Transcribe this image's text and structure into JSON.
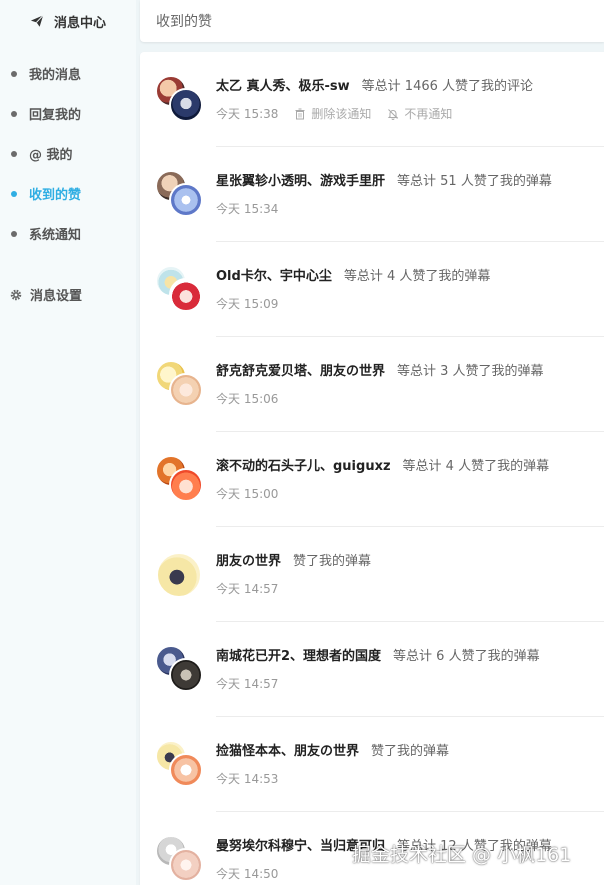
{
  "sidebar": {
    "header": "消息中心",
    "items": [
      {
        "label": "我的消息",
        "active": false
      },
      {
        "label": "回复我的",
        "active": false
      },
      {
        "label": "@ 我的",
        "active": false
      },
      {
        "label": "收到的赞",
        "active": true
      },
      {
        "label": "系统通知",
        "active": false
      }
    ],
    "settings": "消息设置"
  },
  "topbar": {
    "title": "收到的赞"
  },
  "ops": {
    "delete": "删除该通知",
    "mute": "不再通知"
  },
  "notifications": [
    {
      "names": "太乙 真人秀、极乐-sw",
      "action": "等总计 1466 人赞了我的评论",
      "time": "今天 15:38"
    },
    {
      "names": "星张翼轸小透明、游戏手里肝",
      "action": "等总计 51 人赞了我的弹幕",
      "time": "今天 15:34"
    },
    {
      "names": "Old卡尔、宇中心尘",
      "action": "等总计 4 人赞了我的弹幕",
      "time": "今天 15:09"
    },
    {
      "names": "舒克舒克爱贝塔、朋友の世界",
      "action": "等总计 3 人赞了我的弹幕",
      "time": "今天 15:06"
    },
    {
      "names": "滚不动的石头子儿、guiguxz",
      "action": "等总计 4 人赞了我的弹幕",
      "time": "今天 15:00"
    },
    {
      "names": "朋友の世界",
      "action": "赞了我的弹幕",
      "time": "今天 14:57"
    },
    {
      "names": "南城花已开2、理想者的国度",
      "action": "等总计 6 人赞了我的弹幕",
      "time": "今天 14:57"
    },
    {
      "names": "捡猫怪本本、朋友の世界",
      "action": "赞了我的弹幕",
      "time": "今天 14:53"
    },
    {
      "names": "曼努埃尔科穆宁、当归意可归",
      "action": "等总计 12 人赞了我的弹幕",
      "time": "今天 14:50"
    }
  ],
  "watermark": "掘金技术社区 @ 小枫161",
  "colors": {
    "accent": "#2faee3",
    "background": "#eef5f7"
  }
}
